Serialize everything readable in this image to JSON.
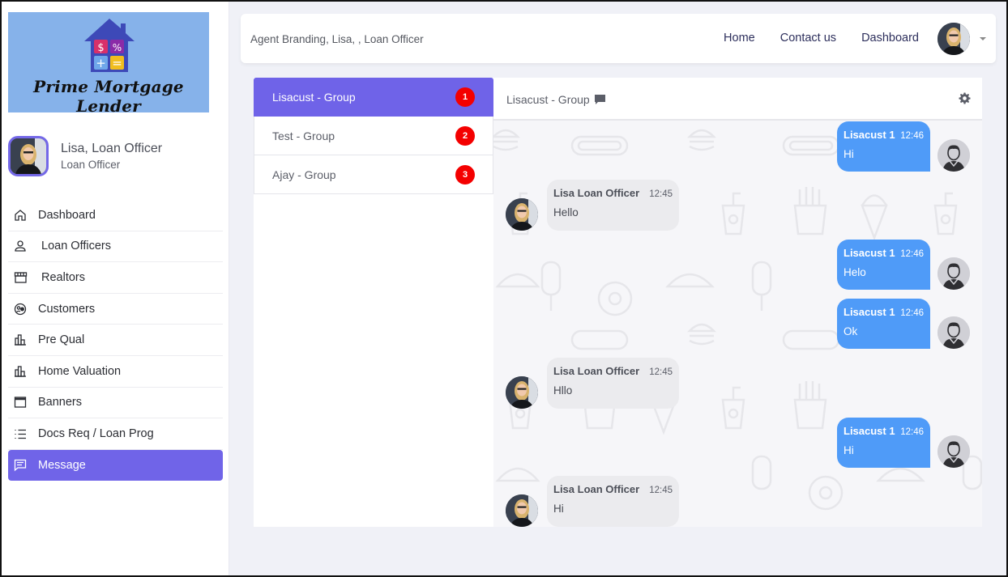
{
  "sidebar": {
    "logo_text": "Prime Mortgage Lender",
    "logo_tiles": [
      "$",
      "%",
      "+",
      "="
    ],
    "profile": {
      "name": "Lisa, Loan Officer",
      "role": "Loan Officer"
    },
    "items": [
      {
        "label": "Dashboard",
        "icon": "home-icon"
      },
      {
        "label": "Loan Officers",
        "icon": "user-icon"
      },
      {
        "label": "Realtors",
        "icon": "store-icon"
      },
      {
        "label": "Customers",
        "icon": "customers-icon"
      },
      {
        "label": "Pre Qual",
        "icon": "bar-chart-icon"
      },
      {
        "label": "Home Valuation",
        "icon": "bar-chart-icon"
      },
      {
        "label": "Banners",
        "icon": "window-icon"
      },
      {
        "label": "Docs Req / Loan Prog",
        "icon": "list-icon"
      },
      {
        "label": "Message",
        "icon": "message-icon",
        "active": true
      }
    ]
  },
  "topbar": {
    "title": "Agent Branding, Lisa, , Loan Officer",
    "links": [
      "Home",
      "Contact us",
      "Dashboard"
    ]
  },
  "groups": [
    {
      "name": "Lisacust - Group",
      "badge": "1",
      "active": true
    },
    {
      "name": "Test - Group",
      "badge": "2"
    },
    {
      "name": "Ajay - Group",
      "badge": "3"
    }
  ],
  "chat": {
    "title": "Lisacust - Group",
    "messages": [
      {
        "type": "sent",
        "sender": "Lisacust 1",
        "time": "12:46",
        "text": "Hi"
      },
      {
        "type": "recv",
        "sender": "Lisa Loan Officer",
        "time": "12:45",
        "text": "Hello"
      },
      {
        "type": "sent",
        "sender": "Lisacust 1",
        "time": "12:46",
        "text": "Helo"
      },
      {
        "type": "sent",
        "sender": "Lisacust 1",
        "time": "12:46",
        "text": "Ok"
      },
      {
        "type": "recv",
        "sender": "Lisa Loan Officer",
        "time": "12:45",
        "text": "Hllo"
      },
      {
        "type": "sent",
        "sender": "Lisacust 1",
        "time": "12:46",
        "text": "Hi"
      },
      {
        "type": "recv",
        "sender": "Lisa Loan Officer",
        "time": "12:45",
        "text": "Hi"
      }
    ]
  },
  "colors": {
    "accent": "#6f63e8",
    "sent_bubble": "#4f9bf8",
    "recv_bubble": "#ebebee",
    "badge": "#f40000",
    "logo_bg": "#86b2ea"
  }
}
